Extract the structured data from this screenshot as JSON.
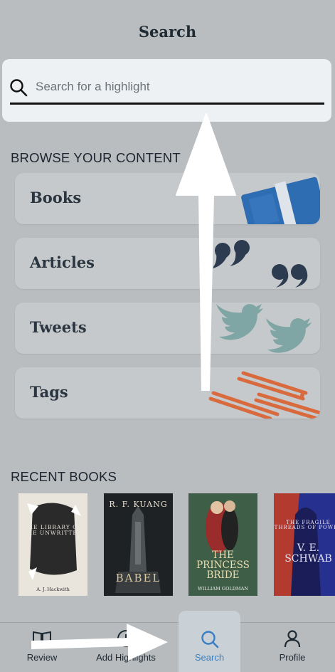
{
  "header": {
    "title": "Search"
  },
  "search": {
    "placeholder": "Search for a highlight"
  },
  "browse": {
    "heading": "BROWSE YOUR CONTENT",
    "items": [
      {
        "label": "Books",
        "icon": "book-icon"
      },
      {
        "label": "Articles",
        "icon": "quote-icon"
      },
      {
        "label": "Tweets",
        "icon": "twitter-bird-icon"
      },
      {
        "label": "Tags",
        "icon": "tag-icon"
      }
    ]
  },
  "recent": {
    "heading": "RECENT BOOKS",
    "books": [
      {
        "title": "THE LIBRARY OF THE UNWRITTEN",
        "author": "A. J. Hackwith"
      },
      {
        "title": "BABEL",
        "author": "R. F. KUANG"
      },
      {
        "title": "THE PRINCESS BRIDE",
        "author": "WILLIAM GOLDMAN"
      },
      {
        "title": "THE FRAGILE THREADS OF POWER",
        "author": "V. E. SCHWAB"
      }
    ]
  },
  "tabbar": {
    "tabs": [
      {
        "label": "Review",
        "icon": "book-open-icon"
      },
      {
        "label": "Add Highlights",
        "icon": "plus-circle-icon"
      },
      {
        "label": "Search",
        "icon": "search-icon",
        "active": true
      },
      {
        "label": "Profile",
        "icon": "person-icon"
      }
    ]
  },
  "colors": {
    "accent": "#3b7ec1",
    "books_blue": "#2f6db3",
    "tags_orange": "#d86a3e",
    "tweets_teal": "#7fa6a5",
    "quote_navy": "#2c3b4f"
  }
}
